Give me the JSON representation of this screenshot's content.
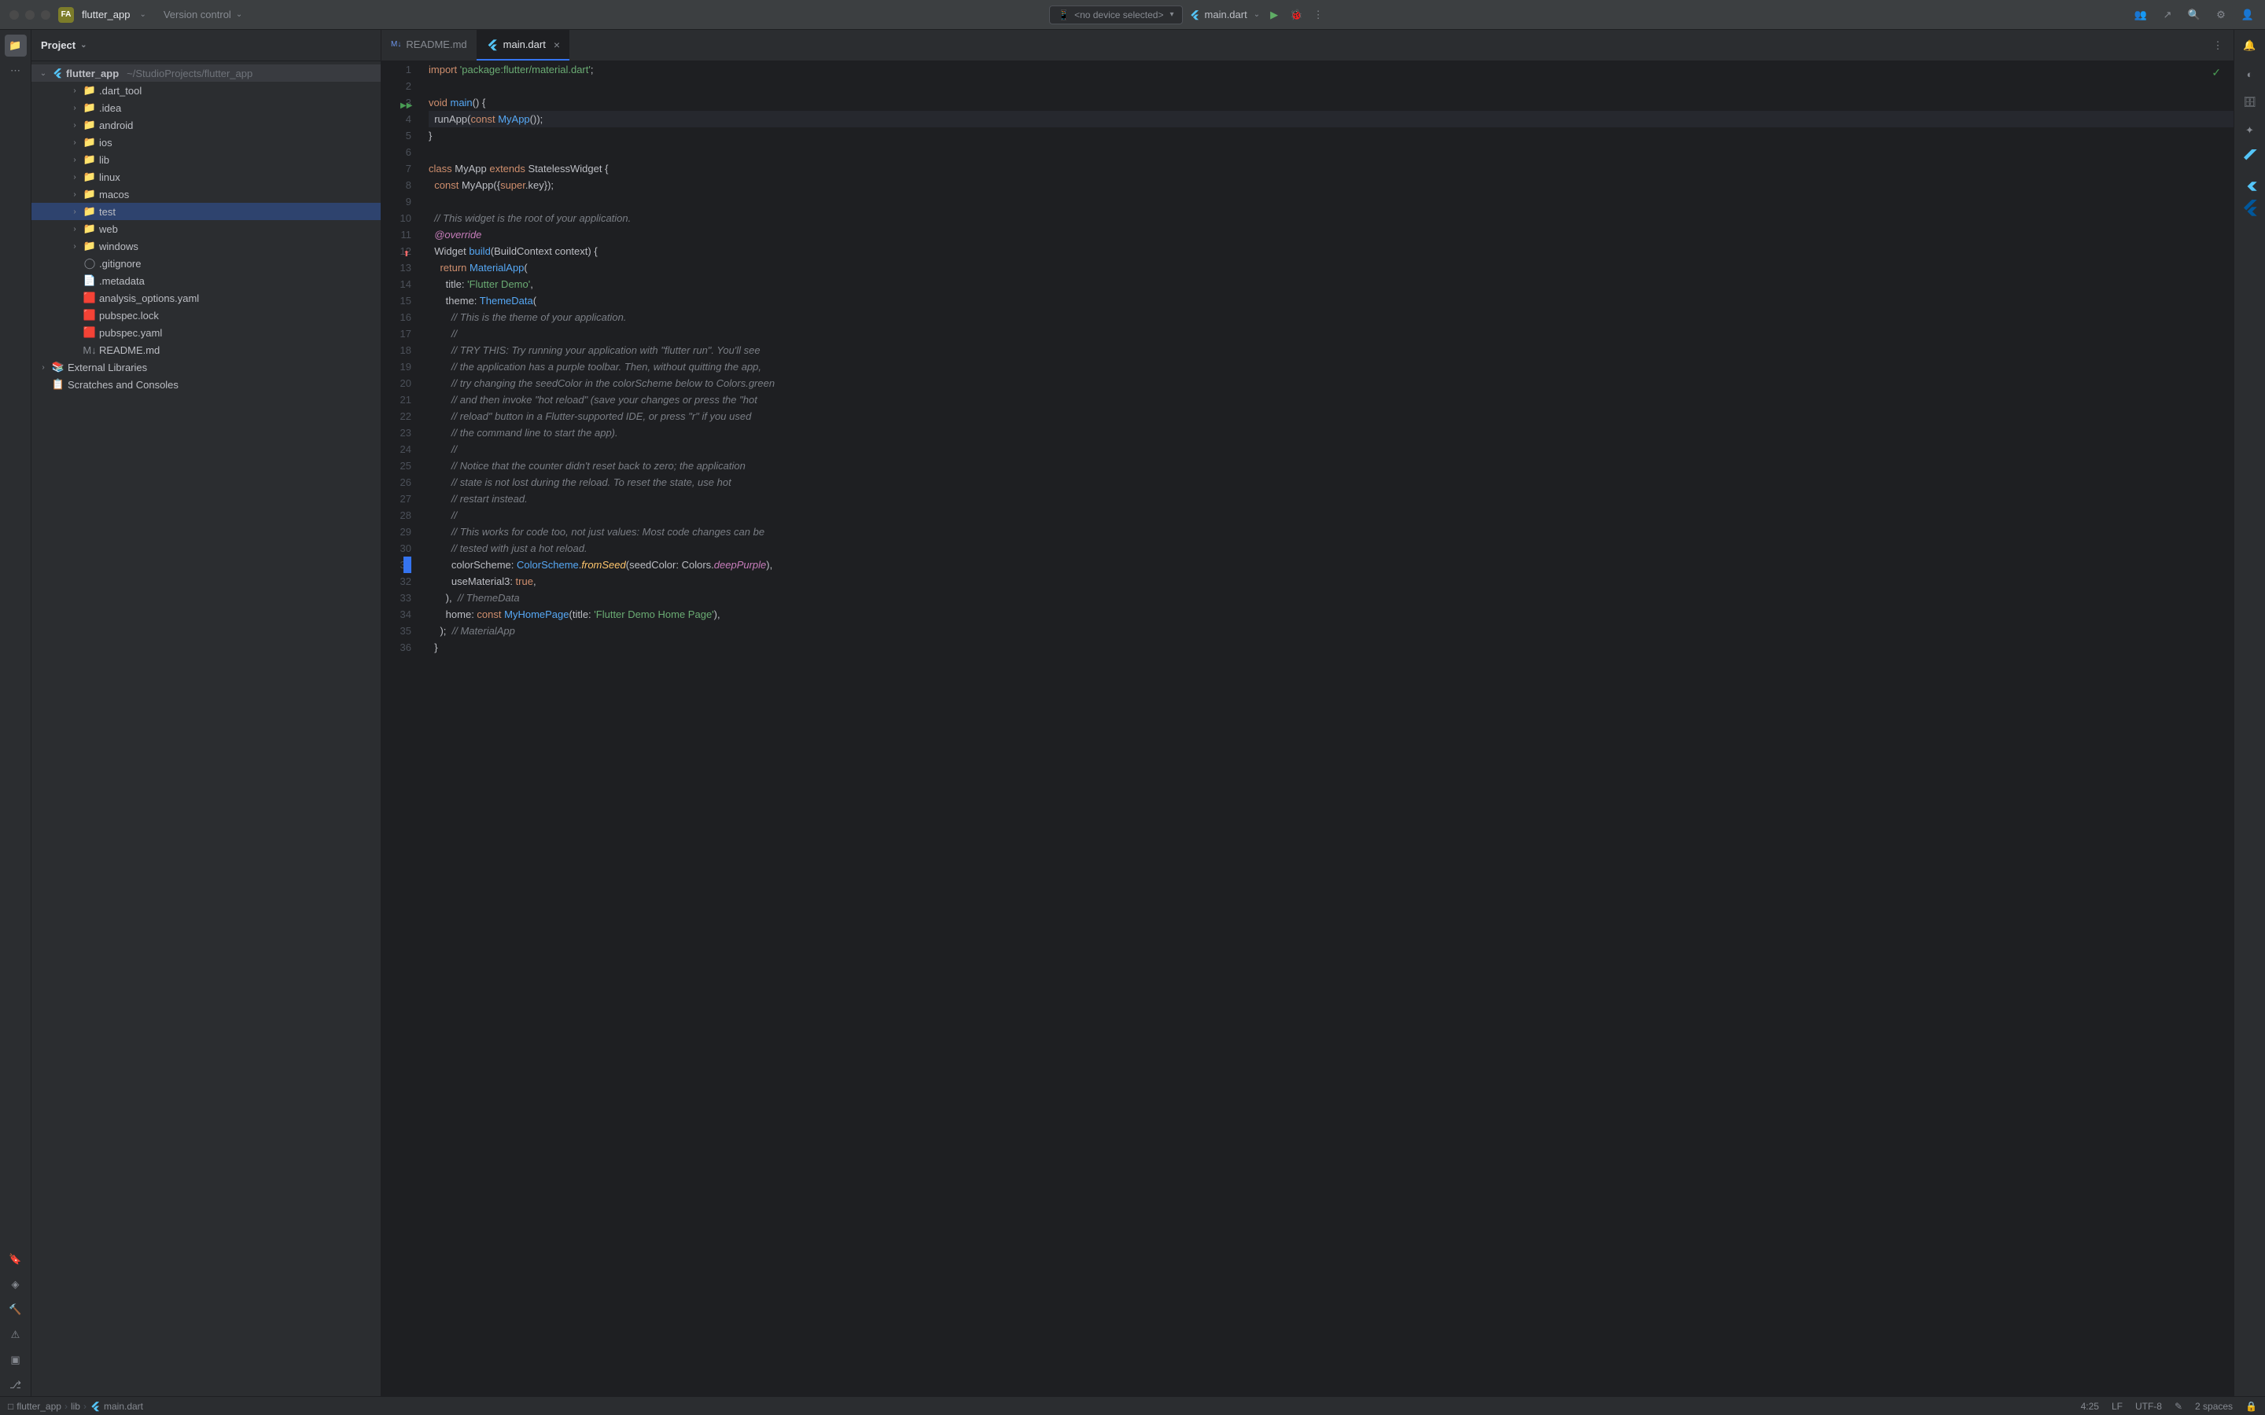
{
  "titlebar": {
    "app_badge": "FA",
    "app_name": "flutter_app",
    "version_control": "Version control",
    "device_selector": "<no device selected>",
    "run_config": "main.dart"
  },
  "sidebar": {
    "title": "Project",
    "root": {
      "name": "flutter_app",
      "path": "~/StudioProjects/flutter_app"
    },
    "items": [
      {
        "label": ".dart_tool",
        "type": "folder",
        "indent": 1
      },
      {
        "label": ".idea",
        "type": "folder",
        "indent": 1
      },
      {
        "label": "android",
        "type": "folder",
        "indent": 1
      },
      {
        "label": "ios",
        "type": "folder",
        "indent": 1
      },
      {
        "label": "lib",
        "type": "folder",
        "indent": 1
      },
      {
        "label": "linux",
        "type": "folder",
        "indent": 1
      },
      {
        "label": "macos",
        "type": "folder",
        "indent": 1
      },
      {
        "label": "test",
        "type": "folder-test",
        "indent": 1,
        "selected": true
      },
      {
        "label": "web",
        "type": "folder",
        "indent": 1
      },
      {
        "label": "windows",
        "type": "folder",
        "indent": 1
      },
      {
        "label": ".gitignore",
        "type": "file-git",
        "indent": 1
      },
      {
        "label": ".metadata",
        "type": "file",
        "indent": 1
      },
      {
        "label": "analysis_options.yaml",
        "type": "file-yaml",
        "indent": 1
      },
      {
        "label": "pubspec.lock",
        "type": "file-yaml",
        "indent": 1
      },
      {
        "label": "pubspec.yaml",
        "type": "file-yaml",
        "indent": 1
      },
      {
        "label": "README.md",
        "type": "file-md",
        "indent": 1
      }
    ],
    "external": "External Libraries",
    "scratches": "Scratches and Consoles"
  },
  "tabs": [
    {
      "label": "README.md",
      "icon": "md"
    },
    {
      "label": "main.dart",
      "icon": "flutter",
      "active": true
    }
  ],
  "code": {
    "lines": [
      {
        "n": 1,
        "html": "<span class='kw'>import</span> <span class='str'>'package:flutter/material.dart'</span>;"
      },
      {
        "n": 2,
        "html": ""
      },
      {
        "n": 3,
        "html": "<span class='kw'>void</span> <span class='fn'>main</span>() {",
        "marker": "run"
      },
      {
        "n": 4,
        "html": "  runApp(<span class='kw'>const</span> <span class='fn'>MyApp</span>());",
        "current": true
      },
      {
        "n": 5,
        "html": "}"
      },
      {
        "n": 6,
        "html": ""
      },
      {
        "n": 7,
        "html": "<span class='kw'>class</span> <span class='cls'>MyApp</span> <span class='kw'>extends</span> <span class='cls'>StatelessWidget</span> {"
      },
      {
        "n": 8,
        "html": "  <span class='kw'>const</span> <span class='cls'>MyApp</span>({<span class='kw'>super</span>.key});"
      },
      {
        "n": 9,
        "html": ""
      },
      {
        "n": 10,
        "html": "  <span class='comment'>// This widget is the root of your application.</span>"
      },
      {
        "n": 11,
        "html": "  <span class='prop'>@override</span>"
      },
      {
        "n": 12,
        "html": "  <span class='cls'>Widget</span> <span class='fn'>build</span>(<span class='cls'>BuildContext</span> context) {",
        "marker": "override"
      },
      {
        "n": 13,
        "html": "    <span class='kw'>return</span> <span class='fn'>MaterialApp</span>("
      },
      {
        "n": 14,
        "html": "      title: <span class='str'>'Flutter Demo'</span>,"
      },
      {
        "n": 15,
        "html": "      theme: <span class='fn'>ThemeData</span>("
      },
      {
        "n": 16,
        "html": "        <span class='comment'>// This is the theme of your application.</span>"
      },
      {
        "n": 17,
        "html": "        <span class='comment'>//</span>"
      },
      {
        "n": 18,
        "html": "        <span class='comment'>// TRY THIS: Try running your application with \"flutter run\". You'll see</span>"
      },
      {
        "n": 19,
        "html": "        <span class='comment'>// the application has a purple toolbar. Then, without quitting the app,</span>"
      },
      {
        "n": 20,
        "html": "        <span class='comment'>// try changing the seedColor in the colorScheme below to Colors.green</span>"
      },
      {
        "n": 21,
        "html": "        <span class='comment'>// and then invoke \"hot reload\" (save your changes or press the \"hot</span>"
      },
      {
        "n": 22,
        "html": "        <span class='comment'>// reload\" button in a Flutter-supported IDE, or press \"r\" if you used</span>"
      },
      {
        "n": 23,
        "html": "        <span class='comment'>// the command line to start the app).</span>"
      },
      {
        "n": 24,
        "html": "        <span class='comment'>//</span>"
      },
      {
        "n": 25,
        "html": "        <span class='comment'>// Notice that the counter didn't reset back to zero; the application</span>"
      },
      {
        "n": 26,
        "html": "        <span class='comment'>// state is not lost during the reload. To reset the state, use hot</span>"
      },
      {
        "n": 27,
        "html": "        <span class='comment'>// restart instead.</span>"
      },
      {
        "n": 28,
        "html": "        <span class='comment'>//</span>"
      },
      {
        "n": 29,
        "html": "        <span class='comment'>// This works for code too, not just values: Most code changes can be</span>"
      },
      {
        "n": 30,
        "html": "        <span class='comment'>// tested with just a hot reload.</span>"
      },
      {
        "n": 31,
        "html": "        colorScheme: <span class='fn'>ColorScheme</span>.<span class='method'>fromSeed</span>(seedColor: <span class='cls'>Colors</span>.<span class='const-val'>deepPurple</span>),",
        "bookmark": true
      },
      {
        "n": 32,
        "html": "        useMaterial3: <span class='kw'>true</span>,"
      },
      {
        "n": 33,
        "html": "      ),  <span class='comment'>// ThemeData</span>"
      },
      {
        "n": 34,
        "html": "      home: <span class='kw'>const</span> <span class='fn'>MyHomePage</span>(title: <span class='str'>'Flutter Demo Home Page'</span>),"
      },
      {
        "n": 35,
        "html": "    );  <span class='comment'>// MaterialApp</span>"
      },
      {
        "n": 36,
        "html": "  }"
      }
    ]
  },
  "breadcrumb": {
    "project": "flutter_app",
    "folder": "lib",
    "file": "main.dart"
  },
  "statusbar": {
    "position": "4:25",
    "line_sep": "LF",
    "encoding": "UTF-8",
    "indent": "2 spaces"
  }
}
